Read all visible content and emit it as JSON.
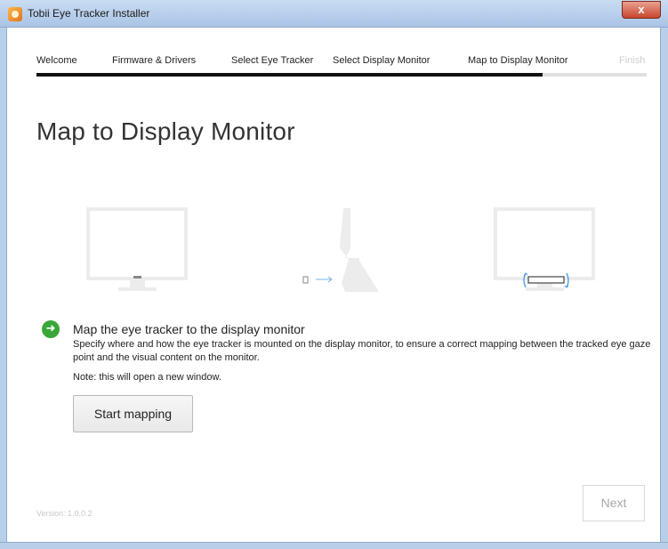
{
  "window": {
    "title": "Tobii Eye Tracker Installer",
    "close_label": "x"
  },
  "steps": [
    {
      "label": "Welcome",
      "state": "done"
    },
    {
      "label": "Firmware & Drivers",
      "state": "done"
    },
    {
      "label": "Select Eye Tracker",
      "state": "done"
    },
    {
      "label": "Select Display Monitor",
      "state": "done"
    },
    {
      "label": "Map to Display Monitor",
      "state": "current"
    },
    {
      "label": "Finish",
      "state": "pending"
    }
  ],
  "progress": {
    "fraction": 0.83
  },
  "page_title": "Map to Display Monitor",
  "illustration": {
    "icons": [
      "monitor-front-icon",
      "monitor-side-icon",
      "monitor-with-eye-tracker-icon"
    ],
    "accent": "#4a9be0"
  },
  "info": {
    "icon": "green-arrow-icon",
    "icon_color": "#3aa63a",
    "title": "Map the eye tracker to the display monitor",
    "description": "Specify where and how the eye tracker is mounted on the display monitor, to ensure a correct mapping between the tracked eye gaze point and the visual content on the monitor.",
    "note": "Note: this will open a new window."
  },
  "buttons": {
    "start_mapping": "Start mapping",
    "next": "Next"
  },
  "version": "Version: 1.0.0.2"
}
